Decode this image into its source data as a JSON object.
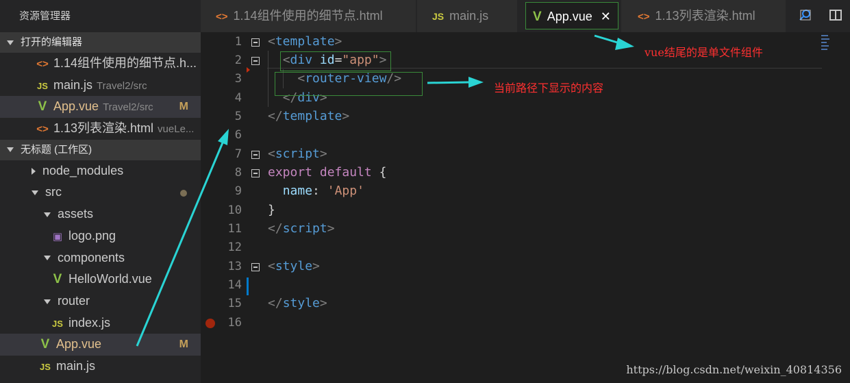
{
  "sidebar": {
    "title": "资源管理器",
    "open_editors_label": "打开的编辑器",
    "open_editors": [
      {
        "icon": "html-icon",
        "glyph": "<>",
        "name": "1.14组件使用的细节点.h...",
        "desc": "",
        "badge": ""
      },
      {
        "icon": "js-icon",
        "glyph": "JS",
        "name": "main.js",
        "desc": "Travel2/src",
        "badge": ""
      },
      {
        "icon": "vue-icon",
        "glyph": "V",
        "name": "App.vue",
        "desc": "Travel2/src",
        "badge": "M"
      },
      {
        "icon": "html-icon",
        "glyph": "<>",
        "name": "1.13列表渲染.html",
        "desc": "vueLe...",
        "badge": ""
      }
    ],
    "workspace_label": "无标题 (工作区)",
    "tree": [
      {
        "name": "node_modules",
        "icon": "folder-closed"
      },
      {
        "name": "src",
        "icon": "folder-open"
      },
      {
        "name": "assets",
        "icon": "folder-open"
      },
      {
        "name": "logo.png",
        "icon": "image-icon",
        "glyph": "▣"
      },
      {
        "name": "components",
        "icon": "folder-open"
      },
      {
        "name": "HelloWorld.vue",
        "icon": "vue-icon",
        "glyph": "V"
      },
      {
        "name": "router",
        "icon": "folder-open"
      },
      {
        "name": "index.js",
        "icon": "js-icon",
        "glyph": "JS"
      },
      {
        "name": "App.vue",
        "icon": "vue-icon",
        "glyph": "V",
        "badge": "M"
      },
      {
        "name": "main.js",
        "icon": "js-icon",
        "glyph": "JS"
      }
    ]
  },
  "tabs": [
    {
      "glyph": "<>",
      "label": "1.14组件使用的细节点.html"
    },
    {
      "glyph": "JS",
      "label": "main.js"
    },
    {
      "glyph": "V",
      "label": "App.vue",
      "close": "✕"
    },
    {
      "glyph": "<>",
      "label": "1.13列表渲染.html"
    }
  ],
  "line_numbers": [
    "1",
    "2",
    "3",
    "4",
    "5",
    "6",
    "7",
    "8",
    "9",
    "10",
    "11",
    "12",
    "13",
    "14",
    "15",
    "16"
  ],
  "annotations": {
    "single_file_component": "vue结尾的是单文件组件",
    "router_view_content": "当前路径下显示的内容"
  },
  "watermark": "https://blog.csdn.net/weixin_40814356",
  "colors": {
    "annotation_text": "#ff3030",
    "arrow": "#2ad4d4",
    "highlight_box": "#3a8a3a"
  }
}
